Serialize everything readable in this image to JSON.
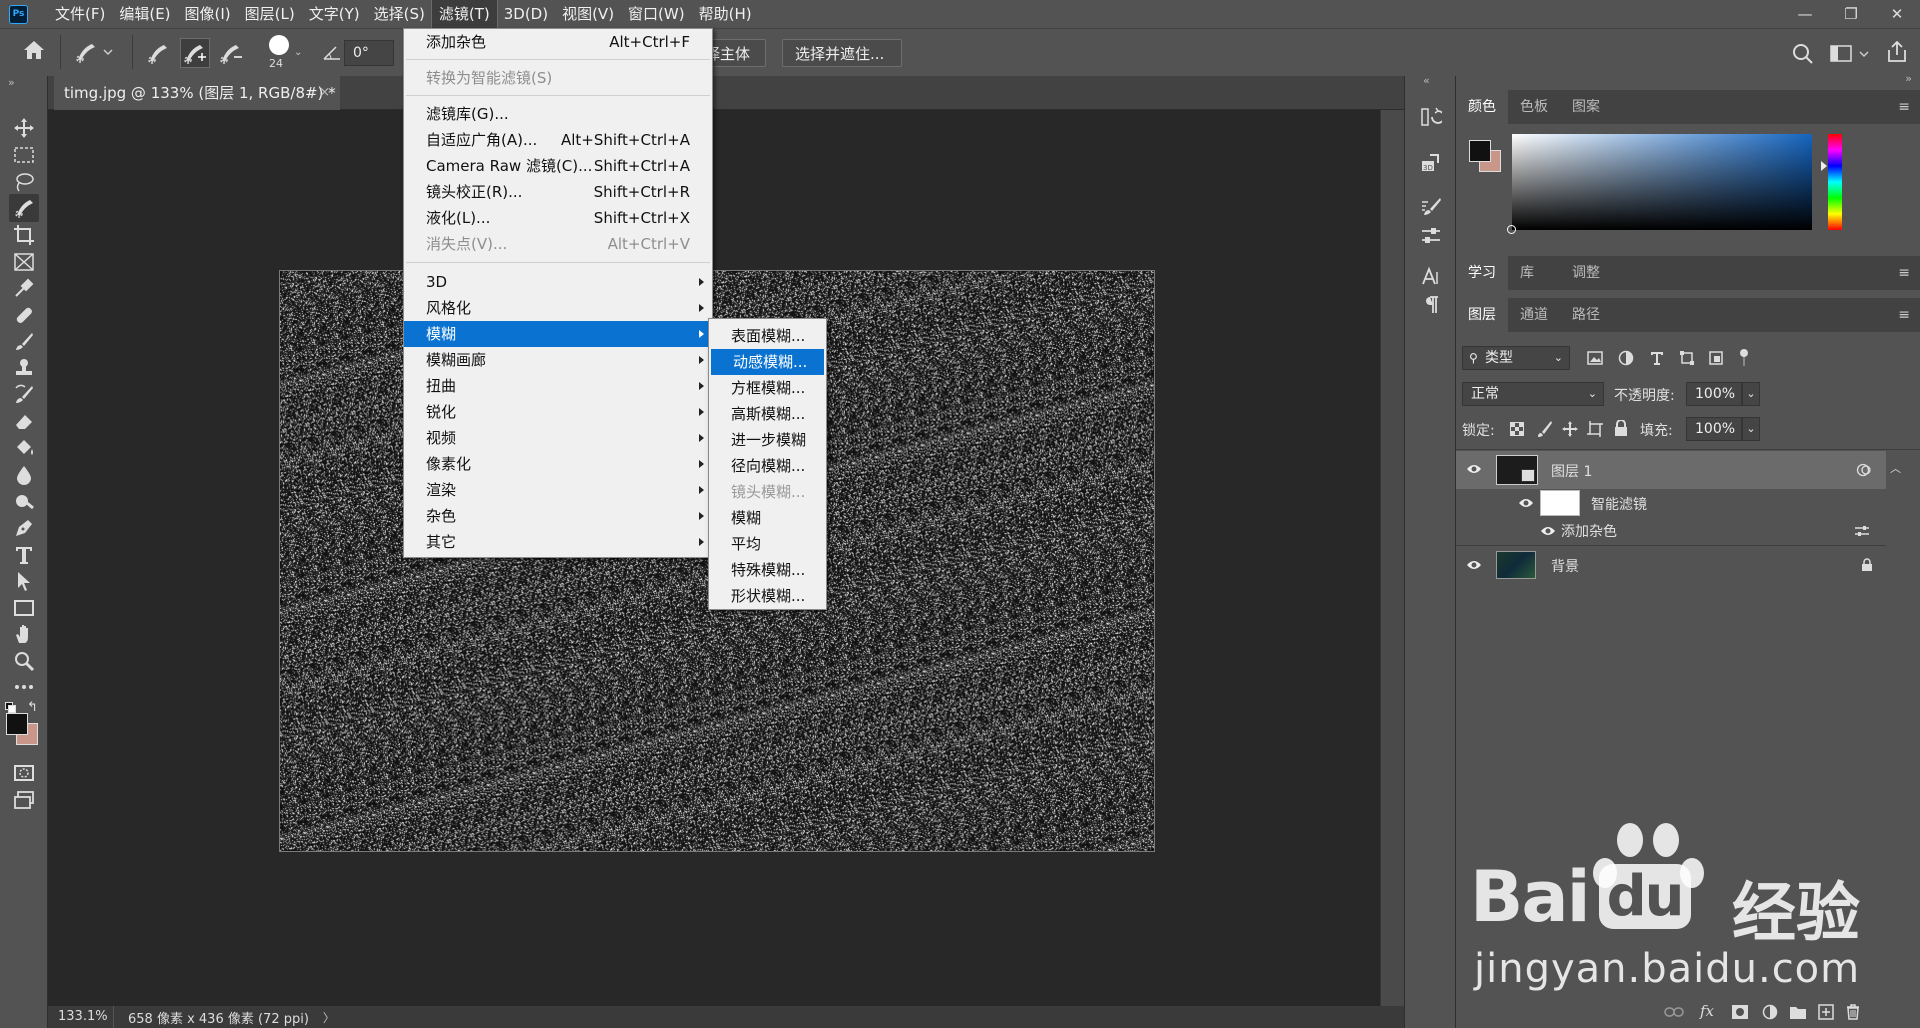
{
  "app": {
    "logo": "Ps"
  },
  "menubar": {
    "items": [
      "文件(F)",
      "编辑(E)",
      "图像(I)",
      "图层(L)",
      "文字(Y)",
      "选择(S)",
      "滤镜(T)",
      "3D(D)",
      "视图(V)",
      "窗口(W)",
      "帮助(H)"
    ],
    "active_index": 6
  },
  "window_controls": [
    "—",
    "❐",
    "✕"
  ],
  "options_bar": {
    "brush_size": "24",
    "angle": "0°",
    "select_subject": "择主体",
    "select_and_mask": "选择并遮住..."
  },
  "document_tab": {
    "title": "timg.jpg @ 133% (图层 1, RGB/8#) *",
    "close": "×"
  },
  "status_bar": {
    "zoom": "133.1%",
    "info": "658 像素 x 436 像素 (72 ppi)",
    "arrow": "〉"
  },
  "filter_menu": {
    "items": [
      {
        "label": "添加杂色",
        "shortcut": "Alt+Ctrl+F",
        "disabled": false
      },
      {
        "label": "转换为智能滤镜(S)",
        "shortcut": "",
        "disabled": true
      },
      {
        "label": "滤镜库(G)...",
        "shortcut": "",
        "disabled": false
      },
      {
        "label": "自适应广角(A)...",
        "shortcut": "Alt+Shift+Ctrl+A",
        "disabled": false
      },
      {
        "label": "Camera Raw 滤镜(C)...",
        "shortcut": "Shift+Ctrl+A",
        "disabled": false
      },
      {
        "label": "镜头校正(R)...",
        "shortcut": "Shift+Ctrl+R",
        "disabled": false
      },
      {
        "label": "液化(L)...",
        "shortcut": "Shift+Ctrl+X",
        "disabled": false
      },
      {
        "label": "消失点(V)...",
        "shortcut": "Alt+Ctrl+V",
        "disabled": true
      },
      {
        "label": "3D",
        "submenu": true
      },
      {
        "label": "风格化",
        "submenu": true
      },
      {
        "label": "模糊",
        "submenu": true,
        "highlighted": true
      },
      {
        "label": "模糊画廊",
        "submenu": true
      },
      {
        "label": "扭曲",
        "submenu": true
      },
      {
        "label": "锐化",
        "submenu": true
      },
      {
        "label": "视频",
        "submenu": true
      },
      {
        "label": "像素化",
        "submenu": true
      },
      {
        "label": "渲染",
        "submenu": true
      },
      {
        "label": "杂色",
        "submenu": true
      },
      {
        "label": "其它",
        "submenu": true
      }
    ]
  },
  "blur_submenu": {
    "items": [
      {
        "label": "表面模糊...",
        "disabled": false
      },
      {
        "label": "动感模糊...",
        "disabled": false,
        "highlighted": true
      },
      {
        "label": "方框模糊...",
        "disabled": false
      },
      {
        "label": "高斯模糊...",
        "disabled": false
      },
      {
        "label": "进一步模糊",
        "disabled": false
      },
      {
        "label": "径向模糊...",
        "disabled": false
      },
      {
        "label": "镜头模糊...",
        "disabled": true
      },
      {
        "label": "模糊",
        "disabled": false
      },
      {
        "label": "平均",
        "disabled": false
      },
      {
        "label": "特殊模糊...",
        "disabled": false
      },
      {
        "label": "形状模糊...",
        "disabled": false
      }
    ]
  },
  "color_panel": {
    "tabs": [
      "颜色",
      "色板",
      "图案"
    ],
    "foreground": "#111111",
    "background": "#c9968a"
  },
  "learn_panel": {
    "tabs": [
      "学习",
      "库",
      "调整"
    ]
  },
  "layers_panel": {
    "tabs": [
      "图层",
      "通道",
      "路径"
    ],
    "filter_kind": "类型",
    "blend_mode": "正常",
    "opacity_label": "不透明度:",
    "opacity": "100%",
    "lock_label": "锁定:",
    "fill_label": "填充:",
    "fill": "100%",
    "layers": [
      {
        "name": "图层 1",
        "selected": true
      },
      {
        "name": "智能滤镜"
      },
      {
        "name": "添加杂色"
      },
      {
        "name": "背景"
      }
    ]
  },
  "watermark": {
    "brand": "Bai",
    "brand2": "du",
    "cn": "经验",
    "url": "jingyan.baidu.com"
  },
  "colors": {
    "highlight": "#0a73d2",
    "ui_dark": "#535353",
    "menu_bg": "#f0f0f0"
  }
}
